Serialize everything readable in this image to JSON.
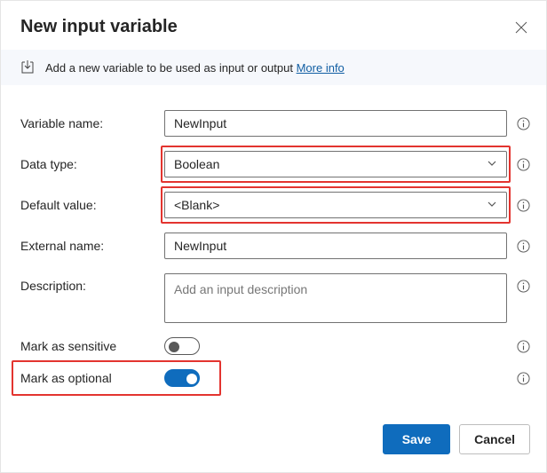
{
  "dialog": {
    "title": "New input variable",
    "info_text": "Add a new variable to be used as input or output",
    "info_link_label": "More info"
  },
  "labels": {
    "variable_name": "Variable name:",
    "data_type": "Data type:",
    "default_value": "Default value:",
    "external_name": "External name:",
    "description": "Description:",
    "mark_sensitive": "Mark as sensitive",
    "mark_optional": "Mark as optional"
  },
  "values": {
    "variable_name": "NewInput",
    "data_type": "Boolean",
    "default_value": "<Blank>",
    "external_name": "NewInput",
    "description": "",
    "description_placeholder": "Add an input description",
    "mark_sensitive": false,
    "mark_optional": true
  },
  "buttons": {
    "save": "Save",
    "cancel": "Cancel"
  }
}
